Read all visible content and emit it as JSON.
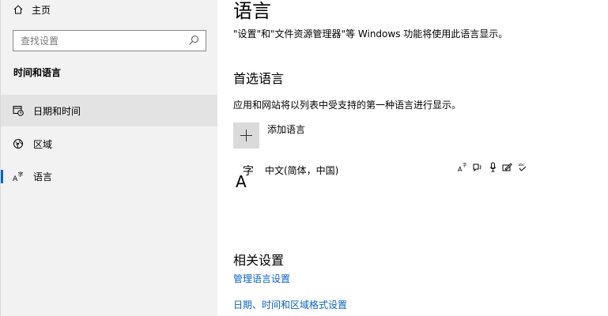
{
  "sidebar": {
    "home_label": "主页",
    "search_placeholder": "查找设置",
    "section_title": "时间和语言",
    "items": [
      {
        "label": "日期和时间",
        "icon": "calendar-clock-icon"
      },
      {
        "label": "区域",
        "icon": "globe-icon"
      },
      {
        "label": "语言",
        "icon": "language-icon"
      }
    ],
    "selected_item": "语言",
    "hovered_item": "日期和时间"
  },
  "main": {
    "title": "语言",
    "description": "\"设置\"和\"文件资源管理器\"等 Windows 功能将使用此语言显示。",
    "preferred_heading": "首选语言",
    "preferred_desc": "应用和网站将以列表中受支持的第一种语言进行显示。",
    "add_language_label": "添加语言",
    "language": {
      "name": "中文(简体，中国)",
      "icon_glyph_a": "A",
      "icon_glyph_zi": "字",
      "feature_icons": [
        "display-language-icon",
        "speech-icon",
        "microphone-icon",
        "handwriting-icon",
        "spellcheck-icon"
      ]
    },
    "related_heading": "相关设置",
    "links": [
      "管理语言设置",
      "日期、时间和区域格式设置"
    ]
  },
  "colors": {
    "accent": "#0a64c8",
    "sidebar_bg": "#f2f2f2",
    "selected_bg": "#e3e3e3",
    "add_button_bg": "#dadada"
  }
}
